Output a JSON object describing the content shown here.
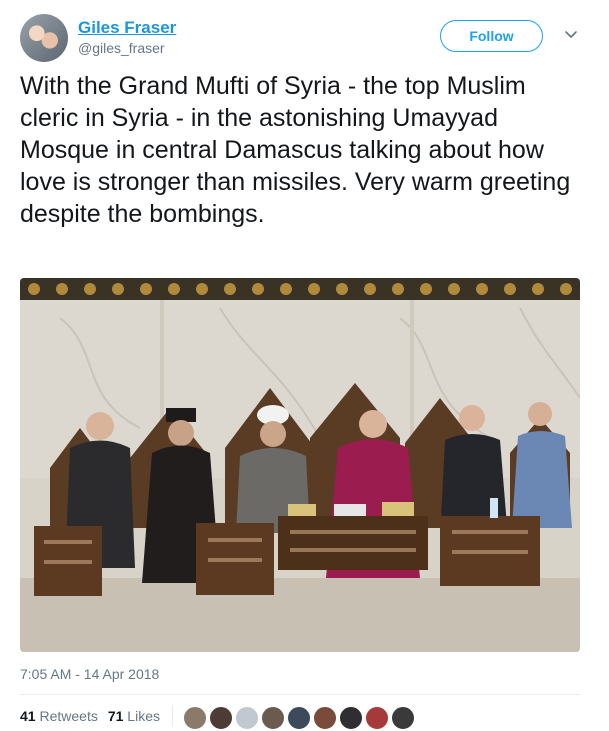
{
  "author": {
    "name": "Giles Fraser",
    "handle": "@giles_fraser"
  },
  "follow_label": "Follow",
  "tweet_text": "With the Grand Mufti of Syria - the top Muslim cleric in Syria - in the astonishing Umayyad Mosque in central Damascus talking about how love is stronger than missiles. Very warm greeting despite the bombings.",
  "timestamp": "7:05 AM - 14 Apr 2018",
  "stats": {
    "retweets_count": "41",
    "retweets_label": "Retweets",
    "likes_count": "71",
    "likes_label": "Likes"
  },
  "colors": {
    "accent": "#1da1f2",
    "link": "#1b95e0",
    "secondary_text": "#657786"
  },
  "icons": {
    "chevron": "chevron-down-icon"
  }
}
